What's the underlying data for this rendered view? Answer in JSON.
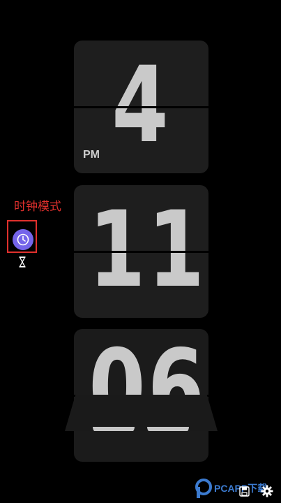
{
  "clock": {
    "hour": "4",
    "minute": "11",
    "second": "06",
    "ampm": "PM"
  },
  "sidebar": {
    "mode_label": "时钟模式",
    "clock_mode_icon": "clock-icon",
    "timer_mode_icon": "hourglass-icon"
  },
  "watermark": {
    "text": "PCAPP下载"
  },
  "bottom_bar": {
    "icons": [
      "save-icon",
      "settings-gear-icon"
    ]
  },
  "colors": {
    "background": "#000000",
    "card": "#1e1e1e",
    "digits": "#c9c9c9",
    "accent": "#7565ea",
    "annotation": "#e0302d"
  }
}
